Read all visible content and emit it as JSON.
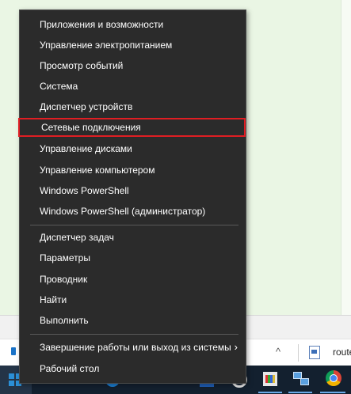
{
  "context_menu": {
    "items": [
      {
        "label": "Приложения и возможности"
      },
      {
        "label": "Управление электропитанием"
      },
      {
        "label": "Просмотр событий"
      },
      {
        "label": "Система"
      },
      {
        "label": "Диспетчер устройств"
      },
      {
        "label": "Сетевые подключения"
      },
      {
        "label": "Управление дисками"
      },
      {
        "label": "Управление компьютером"
      },
      {
        "label": "Windows PowerShell"
      },
      {
        "label": "Windows PowerShell (администратор)"
      },
      {
        "label": "Диспетчер задач"
      },
      {
        "label": "Параметры"
      },
      {
        "label": "Проводник"
      },
      {
        "label": "Найти"
      },
      {
        "label": "Выполнить"
      },
      {
        "label": "Завершение работы или выход из системы",
        "has_submenu": true
      },
      {
        "label": "Рабочий стол"
      }
    ],
    "highlighted_item": "Сетевые подключения",
    "highlight_color": "#e01e23"
  },
  "background_window": {
    "file_name": "router,"
  },
  "taskbar": {
    "icons": [
      "windows-start-icon",
      "edge-icon",
      "store-icon",
      "obs-icon",
      "film-icon",
      "network-icon",
      "chrome-icon"
    ]
  },
  "colors": {
    "menu_bg": "#2b2b2b",
    "taskbar_bg": "#13202f",
    "accent": "#2b8fd6"
  }
}
